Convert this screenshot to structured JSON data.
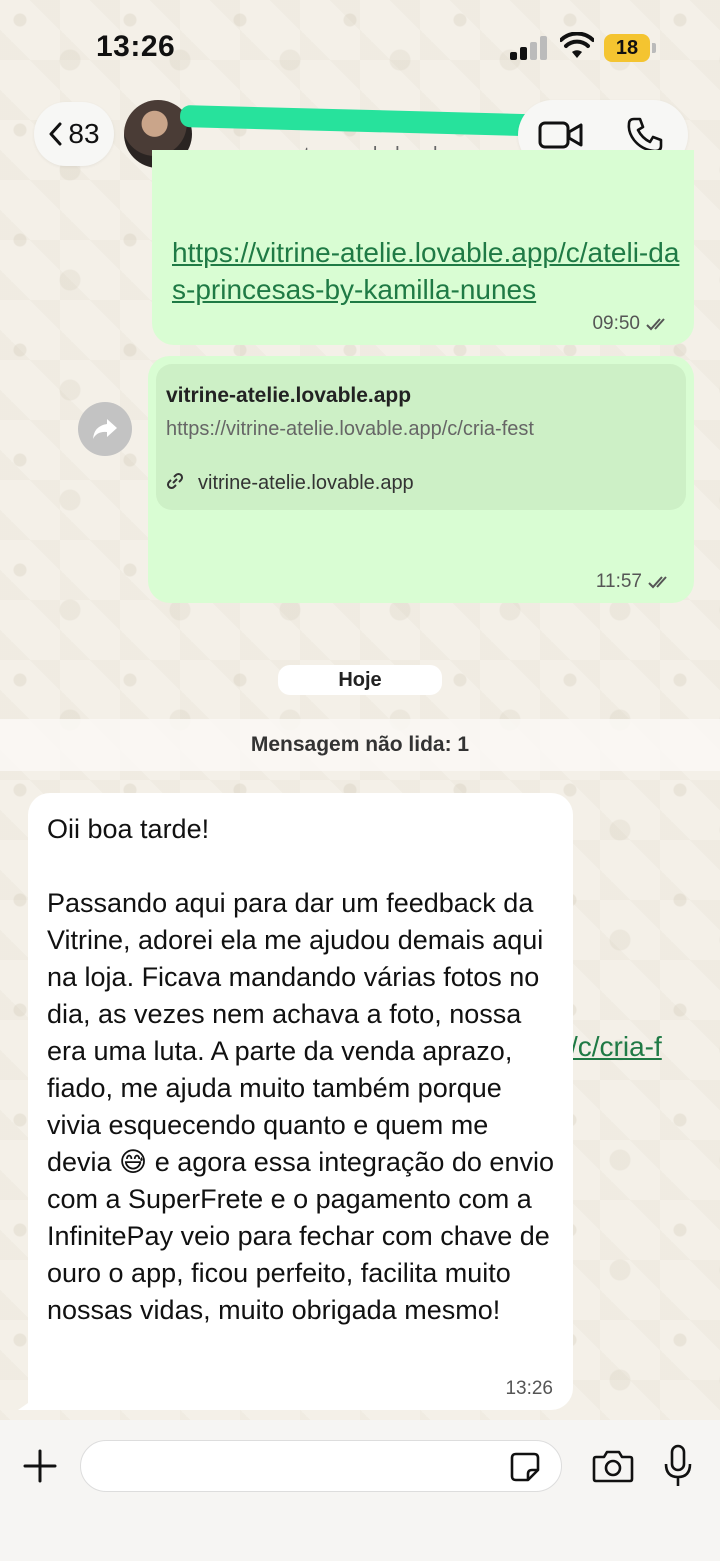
{
  "status_bar": {
    "time": "13:26",
    "battery": "18"
  },
  "header": {
    "back_count": "83",
    "contact_subtitle": "e para mostrar os dados do co"
  },
  "messages": {
    "outgoing_1": {
      "link": "https://vitrine-atelie.lovable.app/c/ateli-das-princesas-by-kamilla-nunes",
      "time": "09:50"
    },
    "outgoing_2": {
      "preview_title": "vitrine-atelie.lovable.app",
      "preview_url": "https://vitrine-atelie.lovable.app/c/cria-fest",
      "preview_domain": "vitrine-atelie.lovable.app",
      "link": "https://vitrine-atelie.lovable.app/c/cria-fest",
      "time": "11:57"
    },
    "date_separator": "Hoje",
    "unread_banner": "Mensagem não lida: 1",
    "incoming_1": {
      "text": "Oii boa tarde!\n\nPassando aqui para dar um feedback da Vitrine, adorei ela me ajudou demais aqui na loja. Ficava mandando várias fotos no dia, as vezes nem achava a foto, nossa era uma luta. A parte da venda aprazo, fiado, me ajuda muito também porque vivia esquecendo quanto e quem me devia 😅 e agora essa integração do envio com a SuperFrete e o pagamento com a InfinitePay veio para fechar com chave de ouro o app, ficou perfeito, facilita muito nossas vidas, muito obrigada mesmo!",
      "time": "13:26"
    }
  },
  "input_bar": {
    "placeholder": ""
  },
  "colors": {
    "outgoing_bubble": "#d9fdd3",
    "link": "#1f7a45",
    "redaction": "#27e29c",
    "battery": "#f4c430"
  },
  "icons": [
    "signal-icon",
    "wifi-icon",
    "battery-icon",
    "back-chevron-icon",
    "video-call-icon",
    "phone-icon",
    "forward-icon",
    "link-icon",
    "double-check-icon",
    "plus-icon",
    "sticker-icon",
    "camera-icon",
    "mic-icon"
  ]
}
